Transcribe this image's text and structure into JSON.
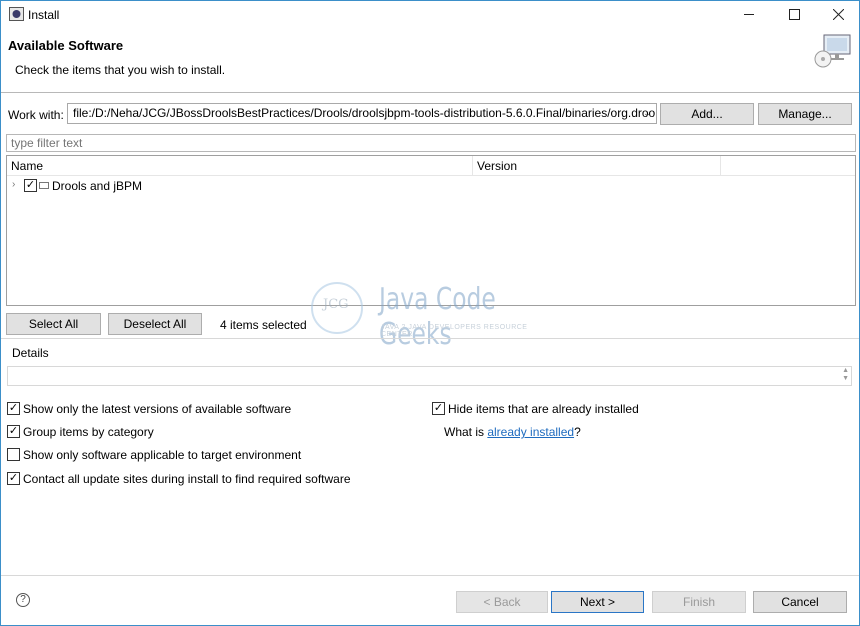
{
  "window": {
    "title": "Install"
  },
  "banner": {
    "title": "Available Software",
    "description": "Check the items that you wish to install."
  },
  "work_with": {
    "label": "Work with:",
    "value": "file:/D:/Neha/JCG/JBossDroolsBestPractices/Drools/droolsjbpm-tools-distribution-5.6.0.Final/binaries/org.drools.update",
    "add_label": "Add...",
    "manage_label": "Manage..."
  },
  "filter": {
    "placeholder": "type filter text"
  },
  "tree": {
    "columns": [
      "Name",
      "Version"
    ],
    "rows": [
      {
        "label": "Drools and jBPM",
        "checked": true,
        "version": ""
      }
    ]
  },
  "selection": {
    "select_all_label": "Select All",
    "deselect_all_label": "Deselect All",
    "count_text": "4 items selected"
  },
  "watermark": {
    "logo_text": "JCG",
    "title": "Java Code Geeks",
    "subtitle": "JAVA 2 JAVA DEVELOPERS RESOURCE CENTER"
  },
  "details": {
    "label": "Details"
  },
  "options": {
    "latest_versions": {
      "label": "Show only the latest versions of available software",
      "checked": true
    },
    "group_by_category": {
      "label": "Group items by category",
      "checked": true
    },
    "applicable_only": {
      "label": "Show only software applicable to target environment",
      "checked": false
    },
    "contact_update_sites": {
      "label": "Contact all update sites during install to find required software",
      "checked": true
    },
    "hide_installed": {
      "label": "Hide items that are already installed",
      "checked": true
    }
  },
  "what_is": {
    "prefix": "What is ",
    "link": "already installed",
    "suffix": "?"
  },
  "footer": {
    "back_label": "< Back",
    "next_label": "Next >",
    "finish_label": "Finish",
    "cancel_label": "Cancel"
  },
  "colors": {
    "accent": "#2a76c6",
    "link": "#1e6bbf",
    "window_border": "#3b8fc9"
  }
}
